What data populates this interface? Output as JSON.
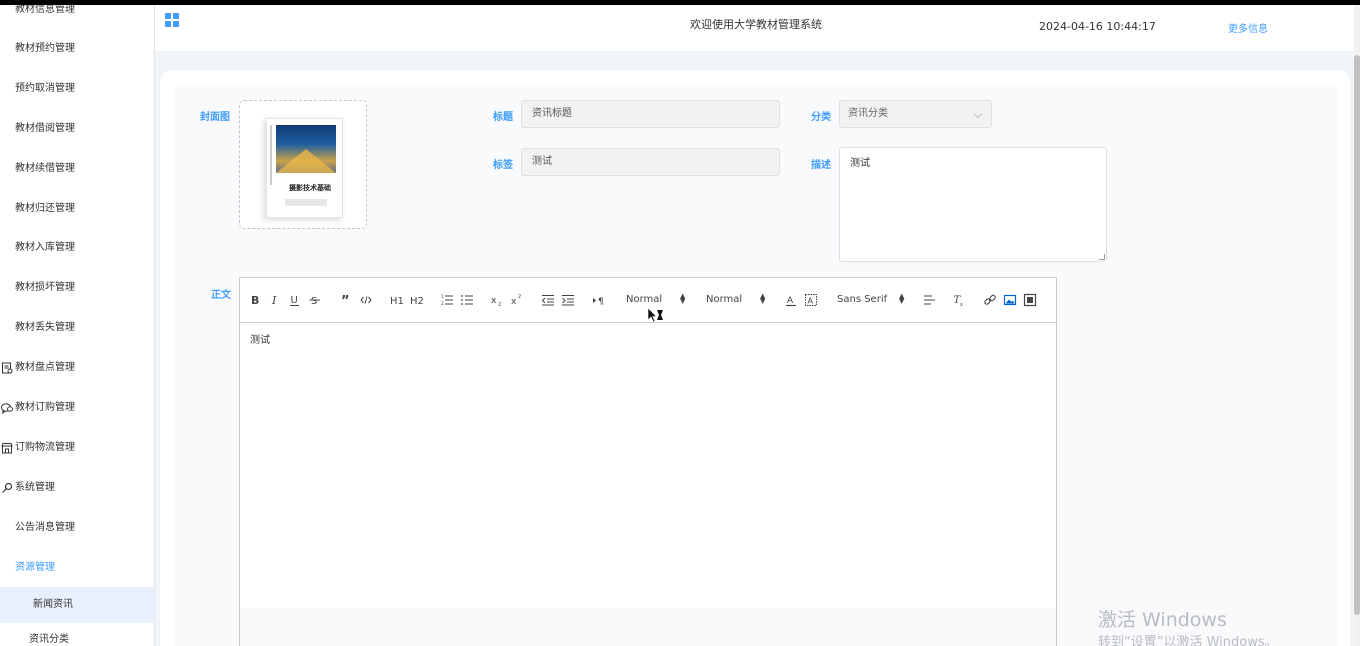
{
  "sidebar": {
    "items": [
      {
        "label": "教材信息管理"
      },
      {
        "label": "教材预约管理"
      },
      {
        "label": "预约取消管理"
      },
      {
        "label": "教材借阅管理"
      },
      {
        "label": "教材续借管理"
      },
      {
        "label": "教材归还管理"
      },
      {
        "label": "教材入库管理"
      },
      {
        "label": "教材损坏管理"
      },
      {
        "label": "教材丢失管理"
      },
      {
        "label": "教材盘点管理",
        "icon": "clipboard-icon"
      },
      {
        "label": "教材订购管理",
        "icon": "chat-icon"
      },
      {
        "label": "订购物流管理",
        "icon": "store-icon"
      },
      {
        "label": "系统管理",
        "icon": "key-icon"
      },
      {
        "label": "公告消息管理"
      },
      {
        "label": "资源管理"
      },
      {
        "label": "新闻资讯"
      },
      {
        "label": "资讯分类"
      }
    ]
  },
  "header": {
    "title": "欢迎使用大学教材管理系统",
    "datetime": "2024-04-16 10:44:17",
    "more": "更多信息"
  },
  "form": {
    "cover_label": "封面图",
    "cover_image": {
      "book_title": "摄影技术基础"
    },
    "title_label": "标题",
    "title_value": "资讯标题",
    "category_label": "分类",
    "category_value": "资讯分类",
    "tags_label": "标签",
    "tags_value": "测试",
    "desc_label": "描述",
    "desc_value": "测试",
    "body_label": "正文",
    "body_value": "测试"
  },
  "editor_toolbar": {
    "header_select": "Normal",
    "size_select": "Normal",
    "font_select": "Sans Serif",
    "h1": "H1",
    "h2": "H2"
  },
  "watermark": {
    "line1": "激活 Windows",
    "line2": "转到“设置”以激活 Windows。"
  },
  "colors": {
    "accent": "#409eff",
    "background": "#f0f5fa"
  }
}
